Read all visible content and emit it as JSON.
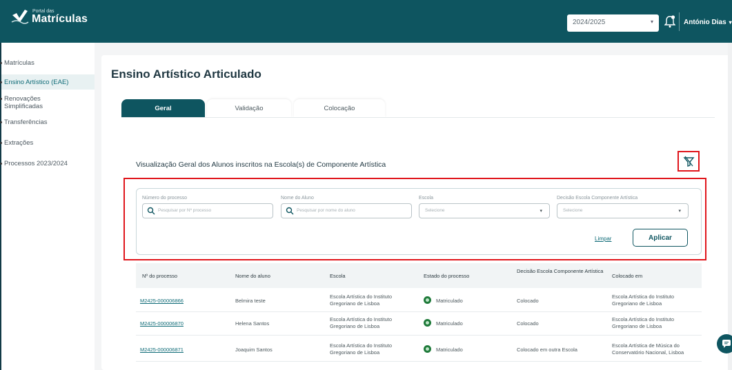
{
  "header": {
    "logo_small": "Portal das",
    "logo_big": "Matrículas",
    "year_value": "2024/2025",
    "user_name": "António Dias"
  },
  "sidebar": {
    "items": [
      {
        "label": "Matrículas"
      },
      {
        "label": "Ensino Artístico (EAE)"
      },
      {
        "label": "Renovações Simplificadas"
      },
      {
        "label": "Transferências"
      },
      {
        "label": "Extrações"
      },
      {
        "label": "Processos 2023/2024"
      }
    ]
  },
  "page": {
    "title": "Ensino Artístico Articulado",
    "tabs": [
      {
        "label": "Geral",
        "active": true
      },
      {
        "label": "Validação"
      },
      {
        "label": "Colocação"
      }
    ],
    "section_title": "Visualização Geral dos Alunos inscritos na Escola(s) de Componente Artística"
  },
  "filters": {
    "process_label": "Número do processo",
    "process_placeholder": "Pesquisar por Nº processo",
    "student_label": "Nome do Aluno",
    "student_placeholder": "Pesquisar por nome do aluno",
    "school_label": "Escola",
    "school_value": "Selecione",
    "decision_label": "Decisão Escola Componente Artística",
    "decision_value": "Selecione",
    "clear_label": "Limpar",
    "apply_label": "Aplicar"
  },
  "table": {
    "headers": [
      "Nº do processo",
      "Nome do aluno",
      "Escola",
      "Estado do processo",
      "Decisão Escola Componente Artística",
      "Colocado em"
    ],
    "rows": [
      {
        "process": "M2425-000006866",
        "name": "Belmira teste",
        "school": "Escola Artística do Instituto Gregoriano de Lisboa",
        "status": "Matriculado",
        "decision": "Colocado",
        "placed": "Escola Artística do Instituto Gregoriano de Lisboa"
      },
      {
        "process": "M2425-000006870",
        "name": "Helena Santos",
        "school": "Escola Artística do Instituto Gregoriano de Lisboa",
        "status": "Matriculado",
        "decision": "Colocado",
        "placed": "Escola Artística do Instituto Gregoriano de Lisboa"
      },
      {
        "process": "M2425-000006871",
        "name": "Joaquim Santos",
        "school": "Escola Artística do Instituto Gregoriano de Lisboa",
        "status": "Matriculado",
        "decision": "Colocado em outra Escola",
        "placed": "Escola Artística de Música do Conservatório Nacional, Lisboa"
      }
    ]
  },
  "colors": {
    "brand": "#0e5560",
    "highlight": "#e0151b",
    "status_ok": "#1f7a3a"
  },
  "icons": [
    "logo-icon",
    "bell-icon",
    "filter-icon",
    "search-icon",
    "chevron-down-icon",
    "chat-icon",
    "status-check-icon"
  ]
}
